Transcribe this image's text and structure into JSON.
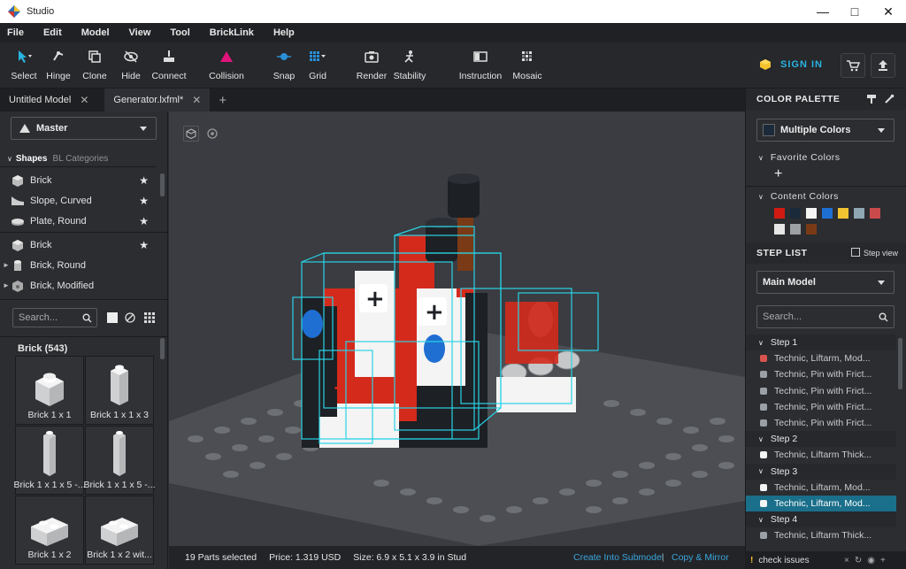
{
  "app": {
    "title": "Studio"
  },
  "menu": [
    "File",
    "Edit",
    "Model",
    "View",
    "Tool",
    "BrickLink",
    "Help"
  ],
  "toolbar": {
    "select": "Select",
    "hinge": "Hinge",
    "clone": "Clone",
    "hide": "Hide",
    "connect": "Connect",
    "collision": "Collision",
    "snap": "Snap",
    "grid": "Grid",
    "render": "Render",
    "stability": "Stability",
    "instruction": "Instruction",
    "mosaic": "Mosaic",
    "sign_in": "SIGN IN"
  },
  "tabs": [
    {
      "label": "Untitled Model"
    },
    {
      "label": "Generator.lxfml*"
    }
  ],
  "left_panel": {
    "palette_select": "Master",
    "shape_tab": "Shapes",
    "bl_tab": "BL Categories",
    "shapes": [
      "Brick",
      "Slope, Curved",
      "Plate, Round"
    ],
    "categories": [
      "Brick",
      "Brick, Round",
      "Brick, Modified"
    ],
    "search_placeholder": "Search...",
    "brick_header": "Brick (543)",
    "parts": [
      "Brick 1 x 1",
      "Brick 1 x 1 x 3",
      "Brick 1 x 1 x 5 -...",
      "Brick 1 x 1 x 5 -...",
      "Brick 1 x 2",
      "Brick 1 x 2 wit..."
    ]
  },
  "status": {
    "selected": "19 Parts selected",
    "price": "Price: 1.319 USD",
    "size": "Size: 6.9 x 5.1 x 3.9 in Stud",
    "create_submodel": "Create Into Submodel",
    "separator": "|",
    "copy_mirror": "Copy & Mirror"
  },
  "right_panel": {
    "color_palette": "COLOR PALETTE",
    "color_select": "Multiple Colors",
    "favorite": "Favorite Colors",
    "content": "Content Colors",
    "content_colors": [
      "#d21a12",
      "#1b2a3a",
      "#f4f4f4",
      "#1e6fd2",
      "#f1c232",
      "#8fa6b3",
      "#c94a4a",
      "#e6e6e6",
      "#9ea1a4",
      "#7a3a15"
    ],
    "step_list": "STEP LIST",
    "step_view": "Step view",
    "model_select": "Main Model",
    "search_placeholder": "Search...",
    "steps": [
      {
        "type": "hdr",
        "label": "Step 1"
      },
      {
        "type": "item",
        "label": "Technic, Liftarm, Mod...",
        "color": "#d9534f"
      },
      {
        "type": "item",
        "label": "Technic, Pin with Frict...",
        "color": "#9aa0a6"
      },
      {
        "type": "item",
        "label": "Technic, Pin with Frict...",
        "color": "#9aa0a6"
      },
      {
        "type": "item",
        "label": "Technic, Pin with Frict...",
        "color": "#9aa0a6"
      },
      {
        "type": "item",
        "label": "Technic, Pin with Frict...",
        "color": "#9aa0a6"
      },
      {
        "type": "hdr",
        "label": "Step 2"
      },
      {
        "type": "item",
        "label": "Technic, Liftarm Thick...",
        "color": "#f4f4f4"
      },
      {
        "type": "hdr",
        "label": "Step 3"
      },
      {
        "type": "item",
        "label": "Technic, Liftarm, Mod...",
        "color": "#f4f4f4"
      },
      {
        "type": "hl",
        "label": "Technic, Liftarm, Mod...",
        "color": "#f4f4f4"
      },
      {
        "type": "hdr",
        "label": "Step 4"
      },
      {
        "type": "item",
        "label": "Technic, Liftarm Thick...",
        "color": "#9aa0a6"
      }
    ],
    "check_issues": "check issues"
  }
}
